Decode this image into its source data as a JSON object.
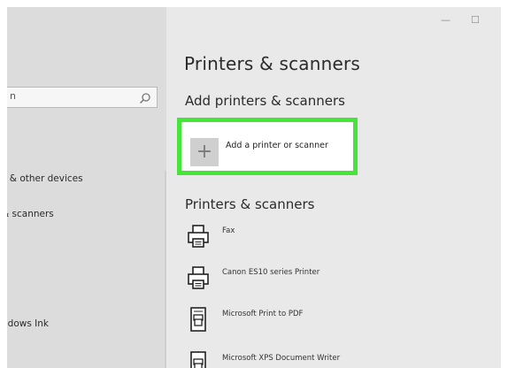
{
  "window": {
    "minimize_glyph": "—",
    "maximize_glyph": "☐"
  },
  "sidebar": {
    "search_text": "n",
    "items": [
      {
        "label": "s & other devices"
      },
      {
        "label": "& scanners"
      },
      {
        "label": "ndows Ink"
      }
    ]
  },
  "main": {
    "page_title": "Printers & scanners",
    "add_section_title": "Add printers & scanners",
    "add_button_label": "Add a printer or scanner",
    "add_button_glyph": "+",
    "list_section_title": "Printers & scanners",
    "printers": [
      {
        "name": "Fax",
        "icon": "printer-icon"
      },
      {
        "name": "Canon ES10 series Printer",
        "icon": "printer-icon"
      },
      {
        "name": "Microsoft Print to PDF",
        "icon": "pdf-printer-icon"
      },
      {
        "name": "Microsoft XPS Document Writer",
        "icon": "document-printer-icon"
      }
    ]
  },
  "colors": {
    "highlight": "#45e53a",
    "window_bg": "#e9e9e9",
    "sidebar_bg": "#dcdcdc"
  }
}
